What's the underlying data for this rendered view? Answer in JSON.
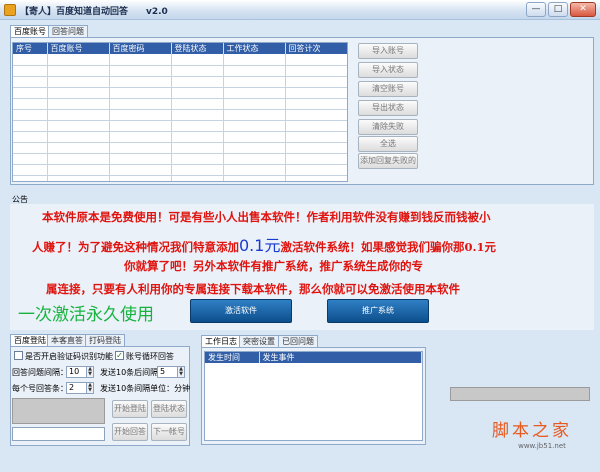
{
  "titlebar": {
    "title": "【寄人】百度知道自动回答　　v2.0",
    "controls": {
      "minimize": "—",
      "maximize": "□",
      "close": "✕"
    }
  },
  "top_tabs": [
    "百度账号",
    "回答问题"
  ],
  "account_table": {
    "columns": [
      "序号",
      "百度账号",
      "百度密码",
      "登陆状态",
      "工作状态",
      "回答计次"
    ],
    "rows": 12
  },
  "side_buttons": [
    "导入账号",
    "导入状态",
    "清空账号",
    "导出状态",
    "清除失败",
    "全选",
    "添加回复失败的"
  ],
  "notice": {
    "label": "公告",
    "line1": "本软件原本是免费使用！可是有些小人出售本软件！作者利用软件没有赚到钱反而钱被小",
    "line2_a": "人赚了！为了避免这种情况我们特意添加",
    "line2_big": "0.1元",
    "line2_b": "激活软件系统！如果感觉我们骗你那0.1元",
    "line3": "你就算了吧！另外本软件有推广系统，推广系统生成你的专",
    "line4": "属连接，只要有人利用你的专属连接下载本软件，那么你就可以免激活使用本软件",
    "green_text": "一次激活永久使用",
    "activate_button": "激活软件",
    "promote_button": "推广系统"
  },
  "bottom_tabs": [
    "百度登陆",
    "本客直答",
    "打码登陆"
  ],
  "login": {
    "captcha_label": "是否开启验证码识别功能",
    "captcha_checked": false,
    "loop_label": "账号循环回答",
    "loop_checked": true,
    "interval_label": "回答问题间隔：",
    "interval_value": "10",
    "after10_label": "发送10条后间隔：",
    "after10_value": "5",
    "per_account_label": "每个号回答条：",
    "per_account_value": "2",
    "unit_label": "发送10条间隔单位：分钟",
    "buttons": [
      "开始登陆",
      "登陆状态",
      "开始回答",
      "下一帐号"
    ]
  },
  "log_tabs": [
    "工作日志",
    "突密设置",
    "已回问题"
  ],
  "log_table": {
    "columns": [
      "发生时间",
      "发生事件"
    ]
  },
  "logo": {
    "main": "脚本之家",
    "sub": "www.jb51.net"
  }
}
